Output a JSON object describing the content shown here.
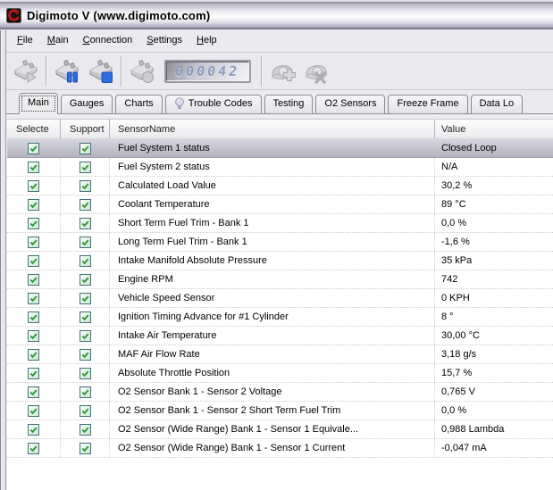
{
  "window": {
    "title": "Digimoto V (www.digimoto.com)"
  },
  "menu": {
    "items": [
      "File",
      "Main",
      "Connection",
      "Settings",
      "Help"
    ]
  },
  "toolbar": {
    "counter_value": "000042",
    "groups": [
      [
        {
          "name": "start-logging-button",
          "icon": "obd-connector-play-icon",
          "shape": "connector",
          "overlay": "play-gray",
          "enabled": false
        }
      ],
      [
        {
          "name": "pause-logging-button",
          "icon": "obd-connector-pause-icon",
          "shape": "connector",
          "overlay": "pause",
          "enabled": true
        },
        {
          "name": "stop-logging-button",
          "icon": "obd-connector-stop-icon",
          "shape": "connector",
          "overlay": "stop",
          "enabled": true
        }
      ],
      [
        {
          "name": "record-button",
          "icon": "obd-connector-record-icon",
          "shape": "connector",
          "overlay": "circle",
          "enabled": false
        }
      ],
      [
        {
          "name": "connect-button",
          "icon": "connector-add-icon",
          "shape": "shell",
          "overlay": "plus",
          "enabled": false
        },
        {
          "name": "disconnect-button",
          "icon": "connector-remove-icon",
          "shape": "shell",
          "overlay": "cross",
          "enabled": false
        }
      ]
    ]
  },
  "tabs": {
    "active": "Main",
    "items": [
      {
        "label": "Main"
      },
      {
        "label": "Gauges"
      },
      {
        "label": "Charts"
      },
      {
        "label": "Trouble Codes",
        "icon": "bulb-icon"
      },
      {
        "label": "Testing"
      },
      {
        "label": "O2 Sensors"
      },
      {
        "label": "Freeze Frame"
      },
      {
        "label": "Data Lo"
      }
    ]
  },
  "table": {
    "columns": [
      "Selecte",
      "Support",
      "SensorName",
      "Value"
    ],
    "rows": [
      {
        "selected": true,
        "supported": true,
        "name": "Fuel System 1 status",
        "value": "Closed Loop",
        "highlighted": true
      },
      {
        "selected": true,
        "supported": true,
        "name": "Fuel System 2 status",
        "value": "N/A",
        "highlighted": false
      },
      {
        "selected": true,
        "supported": true,
        "name": "Calculated Load Value",
        "value": "30,2 %",
        "highlighted": false
      },
      {
        "selected": true,
        "supported": true,
        "name": "Coolant Temperature",
        "value": "89 °C",
        "highlighted": false
      },
      {
        "selected": true,
        "supported": true,
        "name": "Short Term Fuel Trim - Bank 1",
        "value": "0,0 %",
        "highlighted": false
      },
      {
        "selected": true,
        "supported": true,
        "name": "Long Term Fuel Trim - Bank 1",
        "value": "-1,6 %",
        "highlighted": false
      },
      {
        "selected": true,
        "supported": true,
        "name": "Intake Manifold Absolute Pressure",
        "value": "35 kPa",
        "highlighted": false
      },
      {
        "selected": true,
        "supported": true,
        "name": "Engine RPM",
        "value": "742",
        "highlighted": false
      },
      {
        "selected": true,
        "supported": true,
        "name": "Vehicle Speed Sensor",
        "value": "0 KPH",
        "highlighted": false
      },
      {
        "selected": true,
        "supported": true,
        "name": "Ignition Timing Advance for #1 Cylinder",
        "value": "8 °",
        "highlighted": false
      },
      {
        "selected": true,
        "supported": true,
        "name": "Intake Air Temperature",
        "value": "30,00 °C",
        "highlighted": false
      },
      {
        "selected": true,
        "supported": true,
        "name": "MAF Air Flow Rate",
        "value": "3,18 g/s",
        "highlighted": false
      },
      {
        "selected": true,
        "supported": true,
        "name": "Absolute Throttle Position",
        "value": "15,7 %",
        "highlighted": false
      },
      {
        "selected": true,
        "supported": true,
        "name": "O2 Sensor Bank 1 - Sensor 2 Voltage",
        "value": "0,765 V",
        "highlighted": false
      },
      {
        "selected": true,
        "supported": true,
        "name": "O2 Sensor Bank 1 - Sensor 2 Short Term Fuel Trim",
        "value": "0,0 %",
        "highlighted": false
      },
      {
        "selected": true,
        "supported": true,
        "name": "O2 Sensor (Wide Range) Bank 1 - Sensor 1 Equivale...",
        "value": "0,988 Lambda",
        "highlighted": false
      },
      {
        "selected": true,
        "supported": true,
        "name": "O2 Sensor (Wide Range) Bank 1 - Sensor 1 Current",
        "value": "-0,047 mA",
        "highlighted": false
      }
    ]
  }
}
